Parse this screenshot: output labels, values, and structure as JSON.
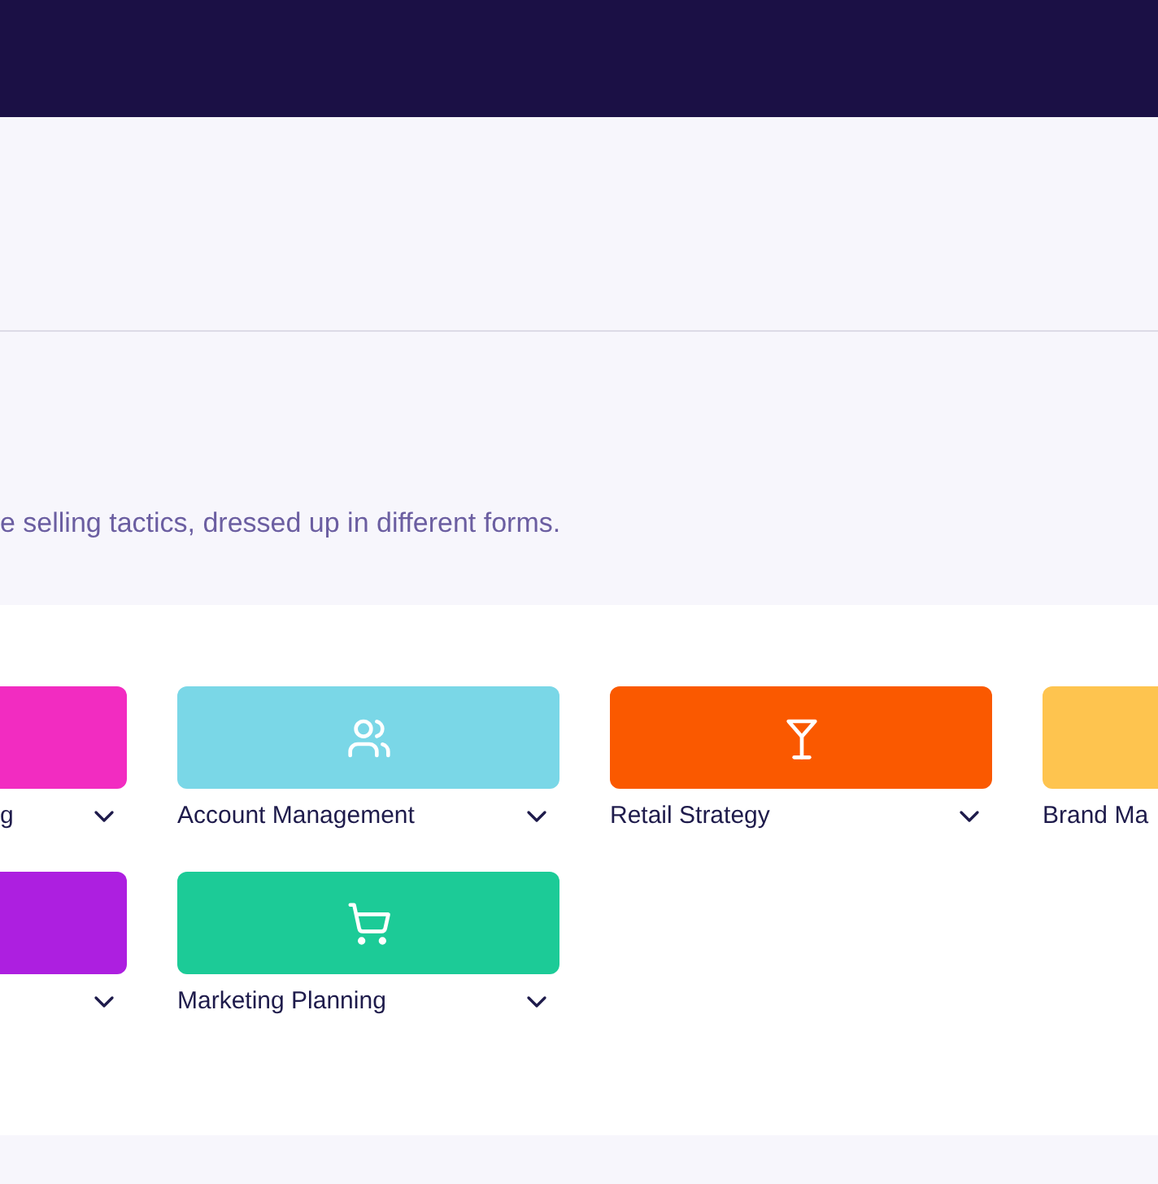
{
  "subtitle": "e selling tactics, dressed up in different forms.",
  "categories": [
    {
      "label": "g",
      "color": "#f22cc1"
    },
    {
      "label": "Account Management",
      "color": "#7ad7e7"
    },
    {
      "label": "Retail Strategy",
      "color": "#fa5900"
    },
    {
      "label": "Brand Ma",
      "color": "#fec44f"
    },
    {
      "color": "#ad1fe0"
    },
    {
      "label": "Marketing Planning",
      "color": "#1ccb97"
    }
  ]
}
